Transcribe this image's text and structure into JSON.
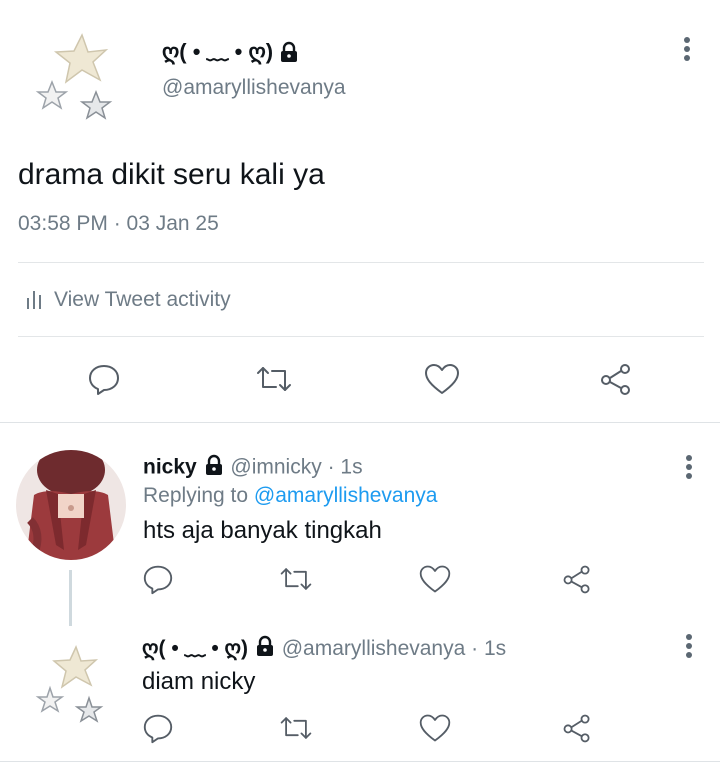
{
  "main_tweet": {
    "display_name": "ღ( • ﹏ • ღ)",
    "handle": "@amaryllishevanya",
    "text": "drama dikit seru kali ya",
    "timestamp": "03:58 PM · 03 Jan 25",
    "activity_label": "View Tweet activity",
    "avatar_icon": "stars-icon"
  },
  "replies": [
    {
      "display_name": "nicky",
      "handle": "@imnicky",
      "time": "· 1s",
      "replying_prefix": "Replying to ",
      "replying_to": "@amaryllishevanya",
      "text": "hts aja banyak tingkah",
      "avatar_icon": "photo-avatar"
    },
    {
      "display_name": "ღ( • ﹏ • ღ)",
      "handle": "@amaryllishevanya",
      "time": "· 1s",
      "text": "diam nicky",
      "avatar_icon": "stars-icon"
    }
  ],
  "colors": {
    "link": "#1d9bf0",
    "muted": "#6e7b86",
    "icon": "#555d66"
  }
}
